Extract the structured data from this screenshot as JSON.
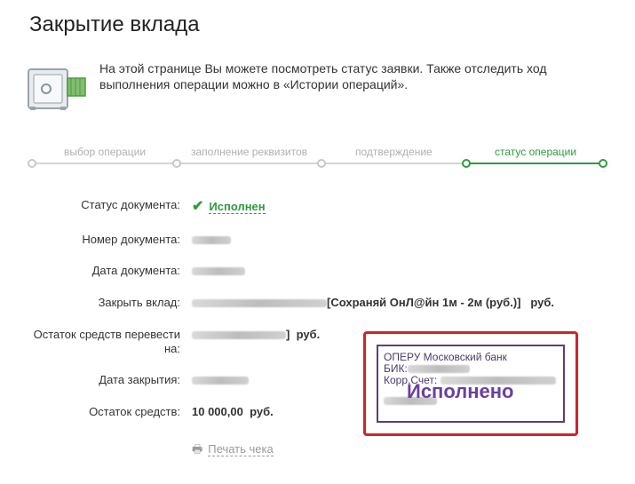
{
  "page": {
    "title": "Закрытие вклада"
  },
  "intro": {
    "text": "На этой странице Вы можете посмотреть статус заявки. Также отследить ход выполнения операции можно в «Истории операций»."
  },
  "steps": [
    {
      "label": "выбор операции",
      "active": false
    },
    {
      "label": "заполнение реквизитов",
      "active": false
    },
    {
      "label": "подтверждение",
      "active": false
    },
    {
      "label": "статус операции",
      "active": true
    }
  ],
  "fields": {
    "status_label": "Статус документа:",
    "status_value": "Исполнен",
    "number_label": "Номер документа:",
    "date_label": "Дата документа:",
    "close_label": "Закрыть вклад:",
    "close_value_suffix": "[Сохраняй ОнЛ@йн 1м - 2м (руб.)]",
    "close_currency": "руб.",
    "transfer_label_1": "Остаток средств перевести",
    "transfer_label_2": "на:",
    "transfer_currency": "руб.",
    "closing_date_label": "Дата закрытия:",
    "balance_label": "Остаток средств:",
    "balance_value": "10 000,00",
    "balance_currency": "руб."
  },
  "print": {
    "label": "Печать чека"
  },
  "stamp": {
    "line1": "ОПЕРУ Московский банк",
    "line2": "БИК:",
    "line3": "Корр.Счет:",
    "big": "Исполнено"
  },
  "colors": {
    "accent_green": "#2f9b41",
    "stamp_border": "#5a3f7c",
    "highlight_red": "#d1222c"
  }
}
